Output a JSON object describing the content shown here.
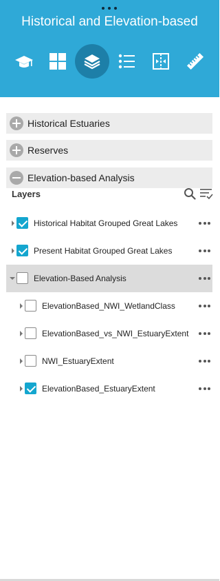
{
  "header": {
    "title": "Historical and Elevation-based",
    "background": "#2fa9d7",
    "active_tool_bg": "#1d7fa8",
    "tools": [
      {
        "icon": "graduation-cap-icon",
        "active": false
      },
      {
        "icon": "grid-icon",
        "active": false
      },
      {
        "icon": "layers-icon",
        "active": true
      },
      {
        "icon": "legend-list-icon",
        "active": false
      },
      {
        "icon": "swipe-icon",
        "active": false
      },
      {
        "icon": "ruler-icon",
        "active": false
      }
    ]
  },
  "sections": [
    {
      "label": "Historical Estuaries",
      "expanded": false
    },
    {
      "label": "Reserves",
      "expanded": false
    },
    {
      "label": "Elevation-based Analysis",
      "expanded": true
    }
  ],
  "layers": {
    "title": "Layers",
    "items": [
      {
        "name": "Historical Habitat Grouped Great Lakes",
        "checked": true,
        "expanded": false,
        "level": 0
      },
      {
        "name": "Present Habitat Grouped Great Lakes",
        "checked": true,
        "expanded": false,
        "level": 0
      },
      {
        "name": "Elevation-Based Analysis",
        "checked": false,
        "expanded": true,
        "level": 0,
        "highlighted": true
      },
      {
        "name": "ElevationBased_NWI_WetlandClass",
        "checked": false,
        "expanded": false,
        "level": 1
      },
      {
        "name": "ElevationBased_vs_NWI_EstuaryExtent",
        "checked": false,
        "expanded": false,
        "level": 1
      },
      {
        "name": "NWI_EstuaryExtent",
        "checked": false,
        "expanded": false,
        "level": 1
      },
      {
        "name": "ElevationBased_EstuaryExtent",
        "checked": true,
        "expanded": false,
        "level": 1
      }
    ]
  },
  "colors": {
    "checkbox_checked": "#14a6cf",
    "section_bg": "#ececec",
    "row_highlight": "#dcdcdc"
  }
}
